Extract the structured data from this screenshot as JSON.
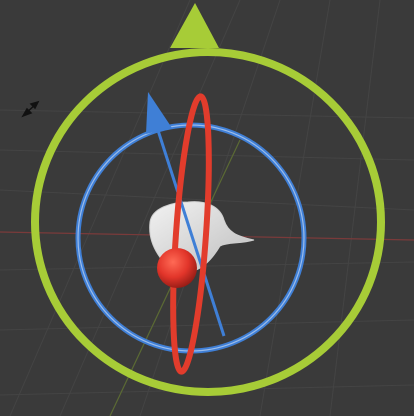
{
  "viewport": {
    "background": "#3a3a3a",
    "grid_color": "#454545",
    "axis_x_color": "#7a3a3a",
    "axis_y_color": "#6d7f3d"
  },
  "gizmo": {
    "view_ring_color": "#a7cc37",
    "view_arrow_color": "#a7cc37",
    "rotate_ring_color": "#3f7fd6",
    "rotate_arrow_color": "#3f7fd6",
    "tilt_ring_color": "#e23c2c",
    "center_handle_color": "#e2352a"
  },
  "object": {
    "color": "#e6e6e6"
  },
  "cursor": {
    "icon": "move-cursor-icon"
  }
}
